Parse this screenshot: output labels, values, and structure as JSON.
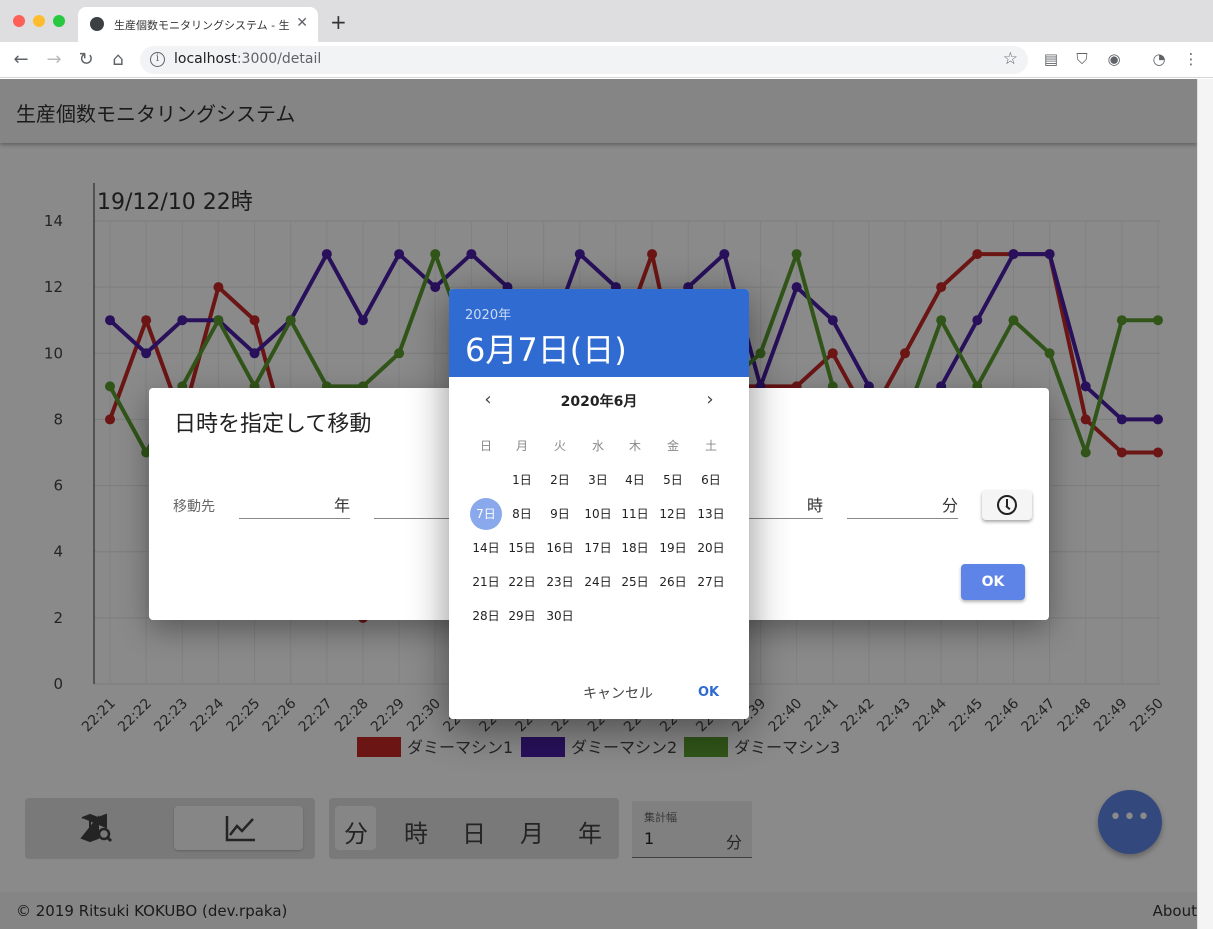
{
  "browser": {
    "tab_title": "生産個数モニタリングシステム - 生",
    "url_host": "localhost",
    "url_path": ":3000/detail"
  },
  "app": {
    "title": "生産個数モニタリングシステム",
    "footer_copyright": "© 2019 Ritsuki KOKUBO (dev.rpaka)",
    "footer_about": "About"
  },
  "chart_data": {
    "type": "line",
    "title": "19/12/10 22時",
    "categories": [
      "22:21",
      "22:22",
      "22:23",
      "22:24",
      "22:25",
      "22:26",
      "22:27",
      "22:28",
      "22:29",
      "22:30",
      "22:31",
      "22:32",
      "22:33",
      "22:34",
      "22:35",
      "22:36",
      "22:37",
      "22:38",
      "22:39",
      "22:40",
      "22:41",
      "22:42",
      "22:43",
      "22:44",
      "22:45",
      "22:46",
      "22:47",
      "22:48",
      "22:49",
      "22:50"
    ],
    "ylim": [
      0,
      14
    ],
    "yticks": [
      "0",
      "2",
      "4",
      "6",
      "8",
      "10",
      "12",
      "14"
    ],
    "grid": true,
    "legend_position": "bottom",
    "series": [
      {
        "name": "ダミーマシン1",
        "color": "#c62828",
        "values": [
          8,
          11,
          8,
          12,
          11,
          7,
          6,
          2,
          7,
          8,
          9,
          10,
          8,
          9,
          10,
          13,
          8,
          9,
          9,
          9,
          10,
          8,
          10,
          12,
          13,
          13,
          13,
          8,
          7,
          7
        ]
      },
      {
        "name": "ダミーマシン2",
        "color": "#4a1fa8",
        "values": [
          11,
          10,
          11,
          11,
          10,
          11,
          13,
          11,
          13,
          12,
          13,
          12,
          10,
          13,
          12,
          11,
          12,
          13,
          9,
          12,
          11,
          9,
          8,
          9,
          11,
          13,
          13,
          9,
          8,
          8
        ]
      },
      {
        "name": "ダミーマシン3",
        "color": "#5b9d2f",
        "values": [
          9,
          7,
          9,
          11,
          9,
          11,
          9,
          9,
          10,
          13,
          10,
          9,
          9,
          8,
          9,
          9,
          8,
          9,
          10,
          13,
          9,
          8,
          8,
          11,
          9,
          11,
          10,
          7,
          11,
          11
        ]
      }
    ]
  },
  "toolbar": {
    "map_icon": "map-search-icon",
    "chart_icon": "line-chart-icon",
    "units": [
      "分",
      "時",
      "日",
      "月",
      "年"
    ],
    "selected_unit": "分",
    "aggregate_label": "集計幅",
    "aggregate_value": "1",
    "aggregate_unit": "分",
    "fab_icon": "more-horiz-icon"
  },
  "move_dialog": {
    "title": "日時を指定して移動",
    "label": "移動先",
    "year_unit": "年",
    "hour_unit": "時",
    "minute_unit": "分",
    "clock_icon": "clock-icon",
    "ok_label": "OK"
  },
  "date_picker": {
    "header_year": "2020年",
    "header_date": "6月7日(日)",
    "month_title": "2020年6月",
    "weekdays": [
      "日",
      "月",
      "火",
      "水",
      "木",
      "金",
      "土"
    ],
    "days": [
      "1日",
      "2日",
      "3日",
      "4日",
      "5日",
      "6日",
      "7日",
      "8日",
      "9日",
      "10日",
      "11日",
      "12日",
      "13日",
      "14日",
      "15日",
      "16日",
      "17日",
      "18日",
      "19日",
      "20日",
      "21日",
      "22日",
      "23日",
      "24日",
      "25日",
      "26日",
      "27日",
      "28日",
      "29日",
      "30日"
    ],
    "first_weekday_index": 1,
    "selected_day": "7日",
    "cancel_label": "キャンセル",
    "ok_label": "OK"
  }
}
